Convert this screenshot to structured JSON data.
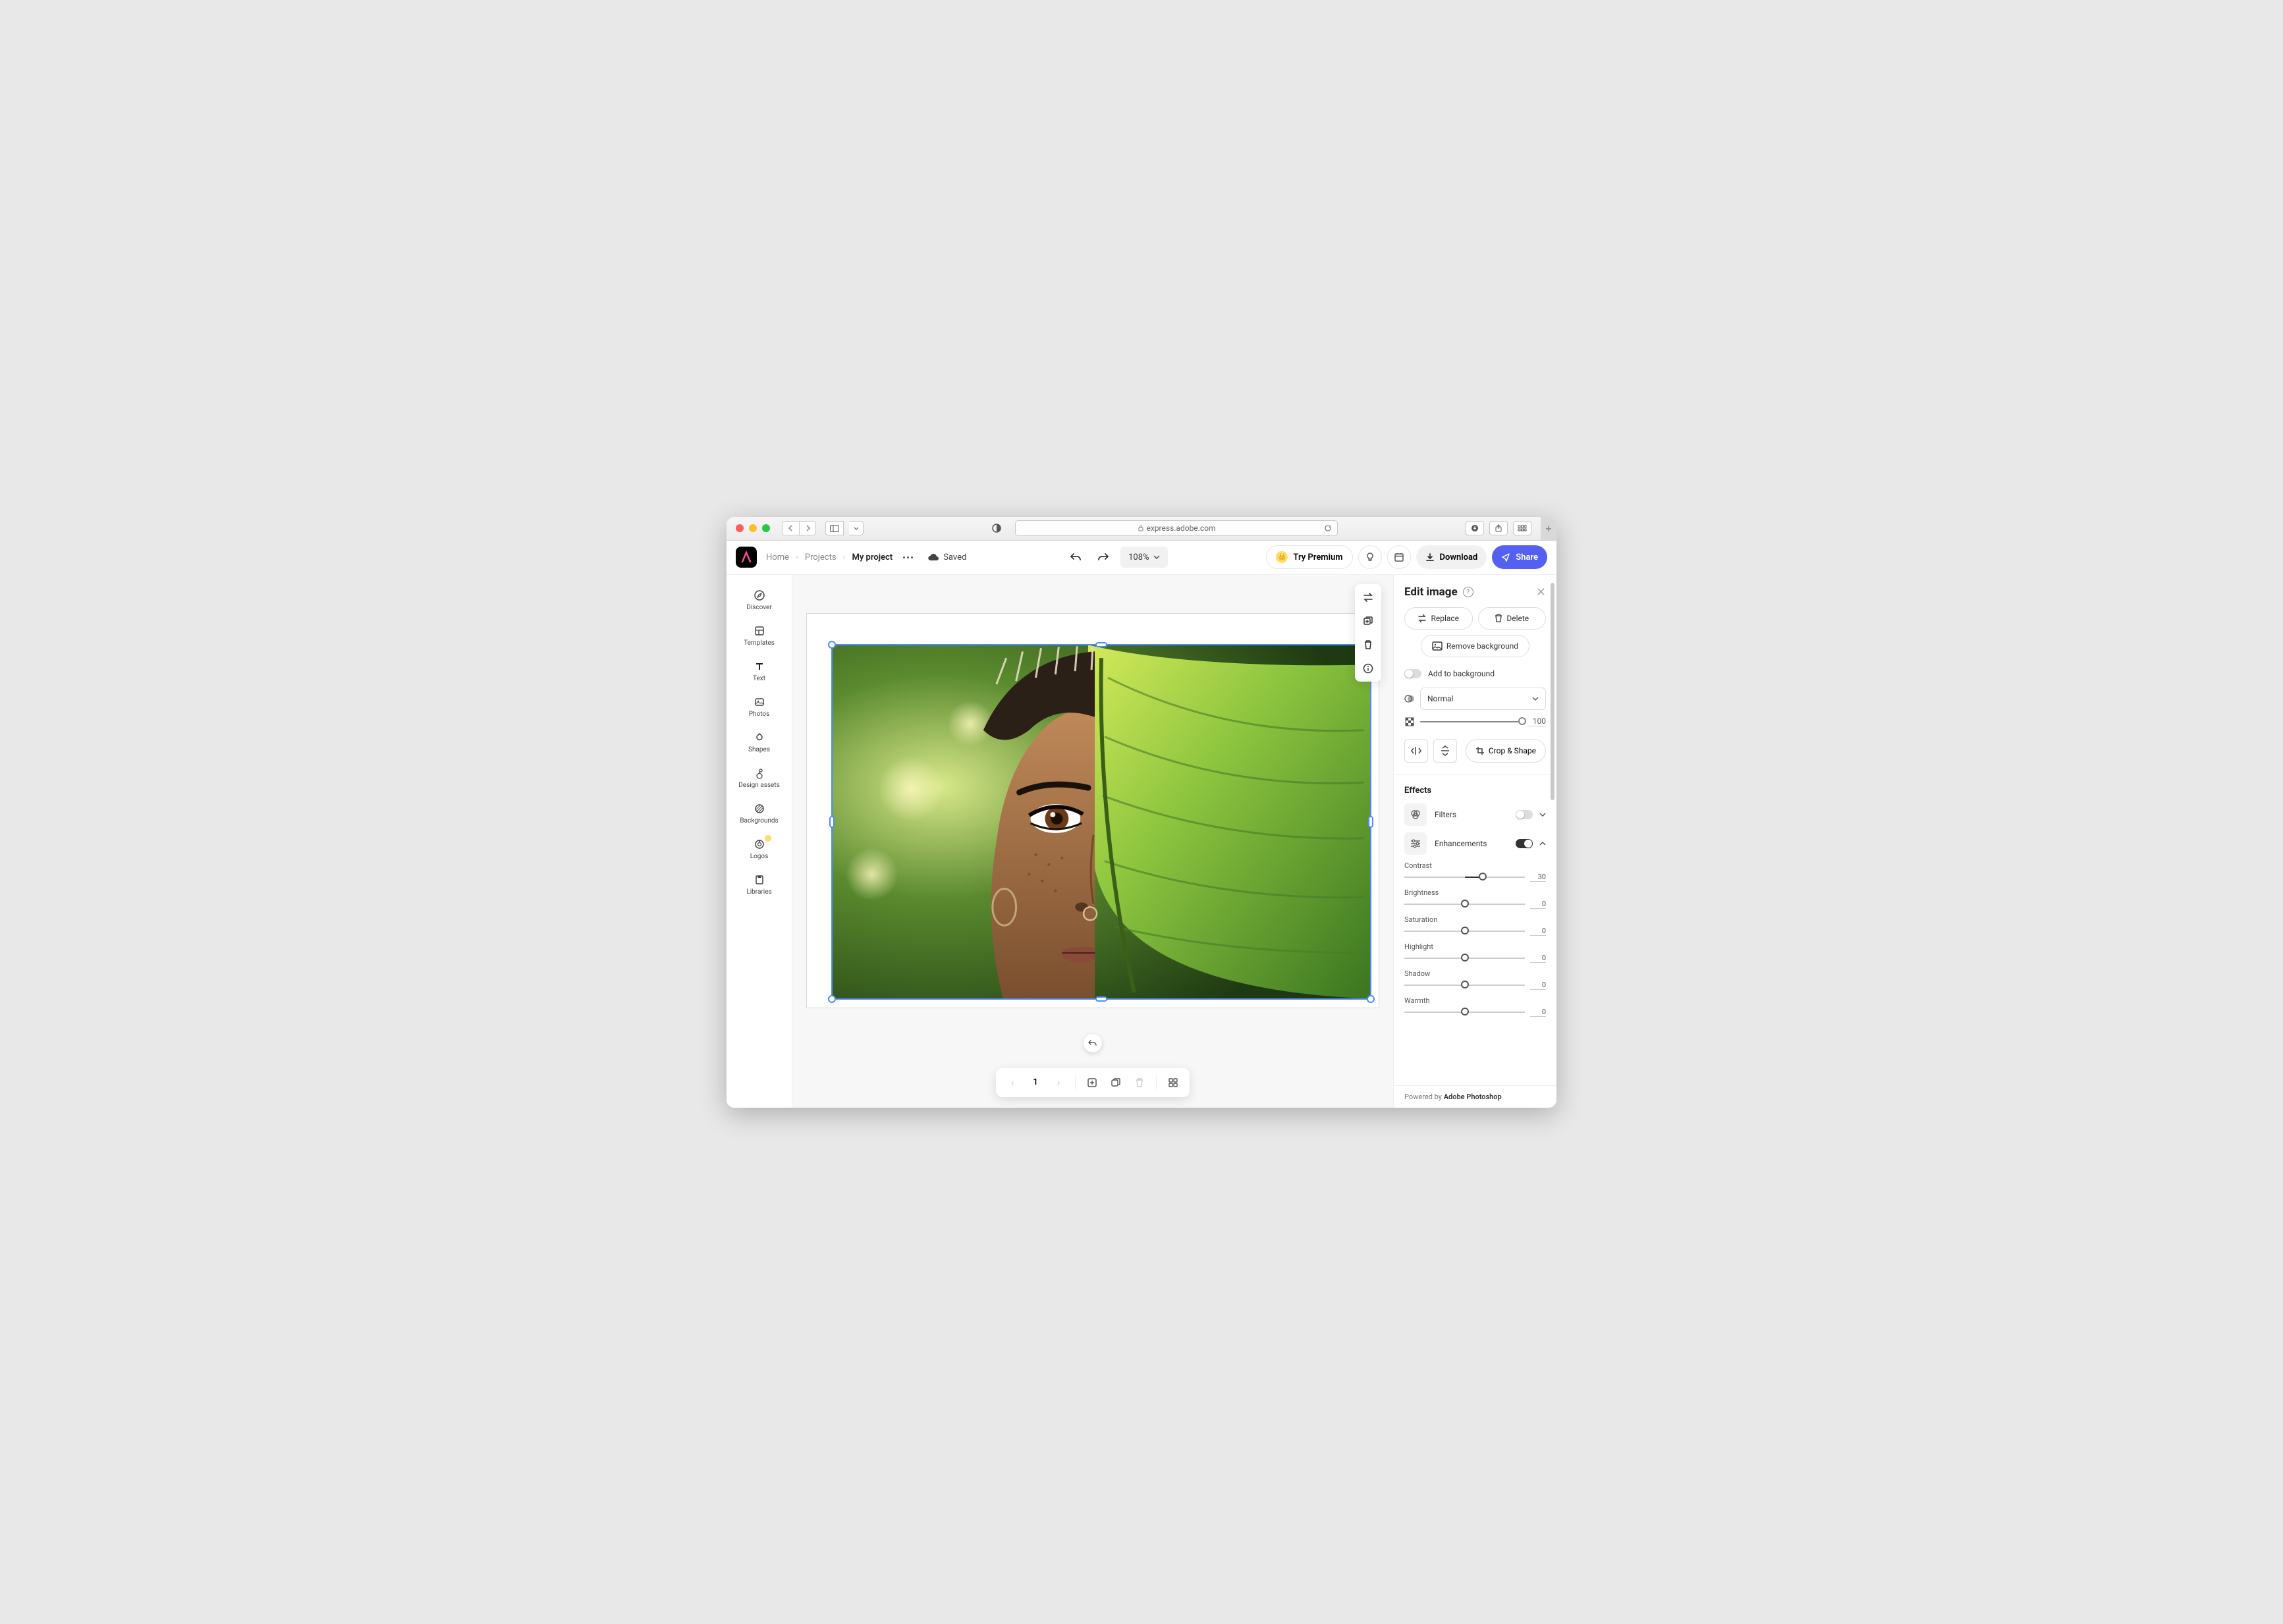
{
  "browser": {
    "url": "express.adobe.com"
  },
  "header": {
    "crumbs": {
      "home": "Home",
      "projects": "Projects",
      "current": "My project"
    },
    "saved": "Saved",
    "zoom": "108%",
    "try_premium": "Try Premium",
    "download": "Download",
    "share": "Share"
  },
  "rail": {
    "discover": "Discover",
    "templates": "Templates",
    "text": "Text",
    "photos": "Photos",
    "shapes": "Shapes",
    "assets": "Design assets",
    "backgrounds": "Backgrounds",
    "logos": "Logos",
    "libraries": "Libraries"
  },
  "bottom": {
    "page": "1"
  },
  "panel": {
    "title": "Edit image",
    "replace": "Replace",
    "delete": "Delete",
    "remove_bg": "Remove background",
    "add_to_bg": "Add to background",
    "blend_mode": "Normal",
    "opacity": "100",
    "crop_shape": "Crop & Shape",
    "effects_title": "Effects",
    "filters": "Filters",
    "enhancements": "Enhancements",
    "enh": {
      "contrast": {
        "label": "Contrast",
        "value": "30"
      },
      "brightness": {
        "label": "Brightness",
        "value": "0"
      },
      "saturation": {
        "label": "Saturation",
        "value": "0"
      },
      "highlight": {
        "label": "Highlight",
        "value": "0"
      },
      "shadow": {
        "label": "Shadow",
        "value": "0"
      },
      "warmth": {
        "label": "Warmth",
        "value": "0"
      }
    },
    "footer_prefix": "Powered by ",
    "footer_brand": "Adobe Photoshop"
  }
}
